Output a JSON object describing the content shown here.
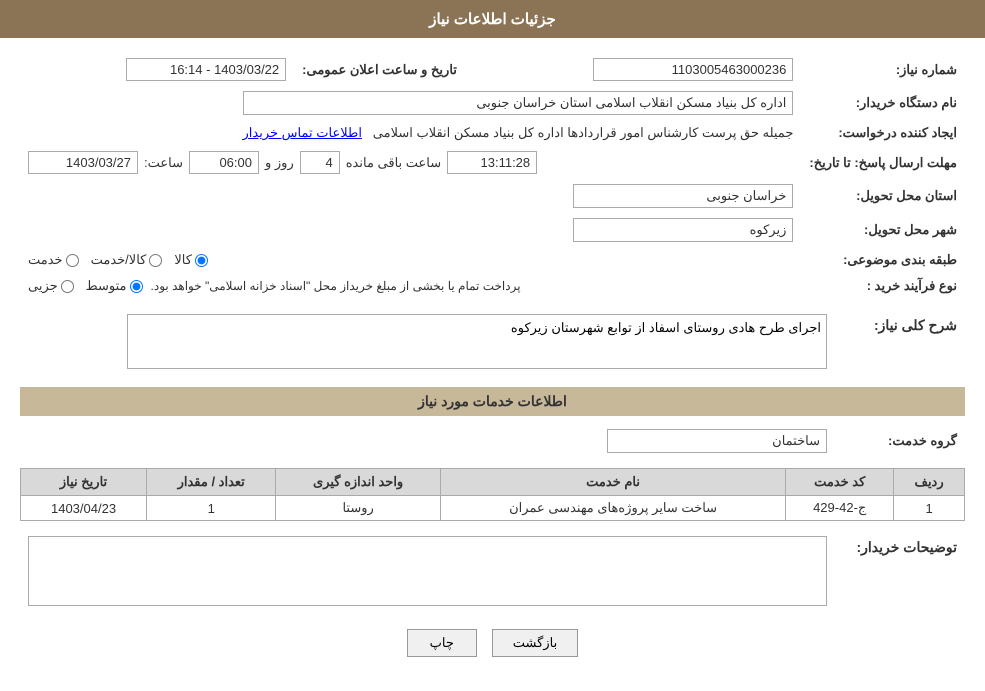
{
  "header": {
    "title": "جزئیات اطلاعات نیاز"
  },
  "fields": {
    "tender_number_label": "شماره نیاز:",
    "tender_number_value": "1103005463000236",
    "announce_date_label": "تاریخ و ساعت اعلان عمومی:",
    "announce_date_value": "1403/03/22 - 16:14",
    "buyer_org_label": "نام دستگاه خریدار:",
    "buyer_org_value": "اداره کل بنیاد مسکن انقلاب اسلامی استان خراسان جنوبی",
    "requester_label": "ایجاد کننده درخواست:",
    "requester_value": "جمیله حق پرست کارشناس امور قراردادها اداره کل بنیاد مسکن انقلاب اسلامی",
    "requester_link": "اطلاعات تماس خریدار",
    "deadline_label": "مهلت ارسال پاسخ: تا تاریخ:",
    "deadline_date": "1403/03/27",
    "deadline_time_label": "ساعت:",
    "deadline_time": "06:00",
    "deadline_days_label": "روز و",
    "deadline_days": "4",
    "deadline_remaining_label": "ساعت باقی مانده",
    "deadline_remaining": "13:11:28",
    "province_label": "استان محل تحویل:",
    "province_value": "خراسان جنوبی",
    "city_label": "شهر محل تحویل:",
    "city_value": "زیرکوه",
    "category_label": "طبقه بندی موضوعی:",
    "category_options": [
      "خدمت",
      "کالا/خدمت",
      "کالا"
    ],
    "category_selected": "کالا",
    "purchase_type_label": "نوع فرآیند خرید :",
    "purchase_type_options": [
      "جزیی",
      "متوسط"
    ],
    "purchase_type_note": "پرداخت تمام یا بخشی از مبلغ خریداز محل \"اسناد خزانه اسلامی\" خواهد بود.",
    "needs_desc_label": "شرح کلی نیاز:",
    "needs_desc_value": "اجرای طرح هادی روستای اسفاد از توابع شهرستان زیرکوه",
    "services_section_label": "اطلاعات خدمات مورد نیاز",
    "service_group_label": "گروه خدمت:",
    "service_group_value": "ساختمان",
    "table": {
      "headers": [
        "ردیف",
        "کد خدمت",
        "نام خدمت",
        "واحد اندازه گیری",
        "تعداد / مقدار",
        "تاریخ نیاز"
      ],
      "rows": [
        {
          "row": "1",
          "code": "ج-42-429",
          "name": "ساخت سایر پروژه‌های مهندسی عمران",
          "unit": "روستا",
          "qty": "1",
          "date": "1403/04/23"
        }
      ]
    },
    "buyer_desc_label": "توضیحات خریدار:",
    "buyer_desc_value": ""
  },
  "buttons": {
    "print_label": "چاپ",
    "back_label": "بازگشت"
  }
}
